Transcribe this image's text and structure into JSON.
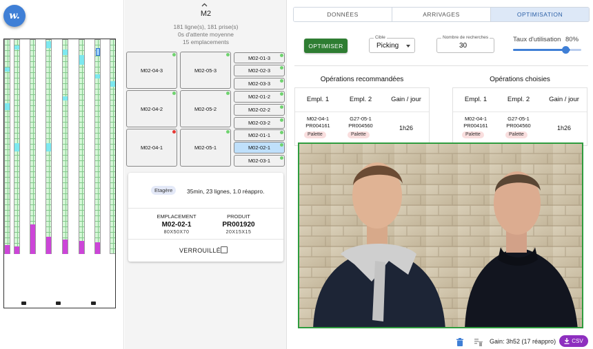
{
  "app": {
    "logo_text": "w."
  },
  "zone": {
    "title": "M2",
    "lines": "181 ligne(s), 181 prise(s)",
    "wait": "0s d'attente moyenne",
    "slots_count": "15 emplacements"
  },
  "slots": {
    "m02_04_3": "M02-04-3",
    "m02_05_3": "M02-05-3",
    "m02_04_2": "M02-04-2",
    "m02_05_2": "M02-05-2",
    "m02_04_1": "M02-04-1",
    "m02_05_1": "M02-05-1",
    "m02_01_3": "M02-01-3",
    "m02_02_3": "M02-02-3",
    "m02_03_3": "M02-03-3",
    "m02_01_2": "M02-01-2",
    "m02_02_2": "M02-02-2",
    "m02_03_2": "M02-03-2",
    "m02_01_1": "M02-01-1",
    "m02_02_1": "M02-02-1",
    "m02_03_1": "M02-03-1"
  },
  "detail": {
    "chip": "Etagère",
    "summary": "35min, 23 lignes, 1.0 réappro.",
    "loc_label": "EMPLACEMENT",
    "loc_value": "M02-02-1",
    "loc_dims": "80X50X70",
    "prod_label": "PRODUIT",
    "prod_value": "PR001920",
    "prod_dims": "20X15X15",
    "lock_label": "VERROUILLÉ"
  },
  "tabs": [
    "DONNÉES",
    "ARRIVAGES",
    "OPTIMISATION"
  ],
  "controls": {
    "optimize_label": "OPTIMISER",
    "cible_label": "Cible",
    "cible_value": "Picking",
    "searches_label": "Nombre de recherches",
    "searches_value": "30",
    "usage_label": "Taux d'utilisation",
    "usage_value": "80%",
    "usage_fraction": 0.8
  },
  "recommended": {
    "title": "Opérations recommandées",
    "headers": [
      "Empl. 1",
      "Empl. 2",
      "Gain / jour"
    ],
    "row": {
      "e1_loc": "M02-04-1",
      "e1_prod": "PR004161",
      "e1_type": "Palette",
      "e2_loc": "G27-05-1",
      "e2_prod": "PR004560",
      "e2_type": "Palette",
      "gain": "1h26"
    }
  },
  "chosen": {
    "title": "Opérations choisies",
    "headers": [
      "Empl. 1",
      "Empl. 2",
      "Gain / jour"
    ],
    "row": {
      "e1_loc": "M02-04-1",
      "e1_prod": "PR004161",
      "e1_type": "Palette",
      "e2_loc": "G27-05-1",
      "e2_prod": "PR004560",
      "e2_type": "Palette",
      "gain": "1h26"
    }
  },
  "footer": {
    "gain_total": "Gain: 3h52 (17 réappro)",
    "csv_label": "CSV"
  },
  "colors": {
    "accent": "#3f7fd6",
    "optimize_green": "#2e7d32",
    "csv_purple": "#8e2fbf",
    "photo_border": "#2e9c3e"
  },
  "icons": [
    "chevron-up-icon",
    "trash-icon",
    "clear-list-icon",
    "download-icon",
    "dropdown-caret-icon"
  ]
}
